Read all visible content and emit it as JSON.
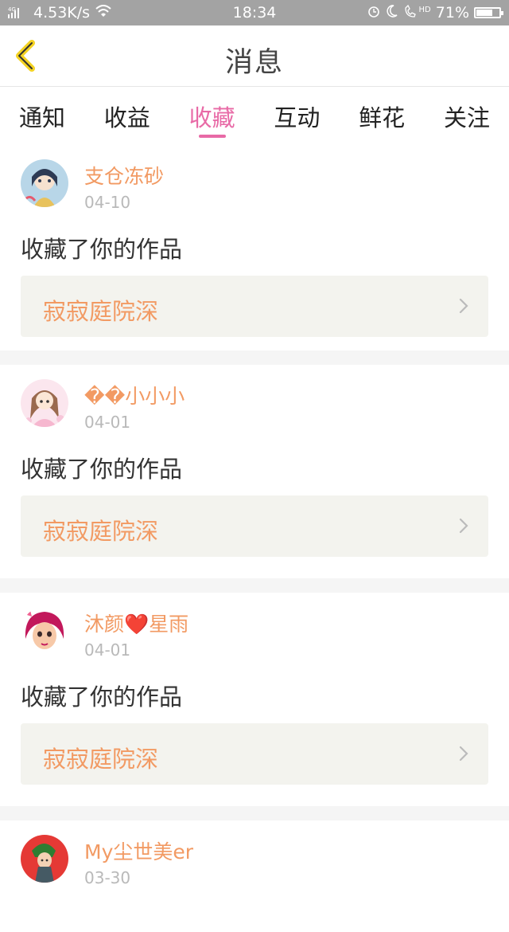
{
  "statusbar": {
    "signal": "4G",
    "speed": "4.53K/s",
    "time": "18:34",
    "network": "HD",
    "battery": "71%",
    "battery_level": 0.71
  },
  "header": {
    "title": "消息"
  },
  "tabs": [
    {
      "label": "通知",
      "active": false
    },
    {
      "label": "收益",
      "active": false
    },
    {
      "label": "收藏",
      "active": true
    },
    {
      "label": "互动",
      "active": false
    },
    {
      "label": "鲜花",
      "active": false
    },
    {
      "label": "关注",
      "active": false
    }
  ],
  "items": [
    {
      "name": "支仓冻砂",
      "date": "04-10",
      "action": "收藏了你的作品",
      "work": "寂寂庭院深"
    },
    {
      "name": "��小小小",
      "date": "04-01",
      "action": "收藏了你的作品",
      "work": "寂寂庭院深"
    },
    {
      "name": "沐颜❤️星雨",
      "date": "04-01",
      "action": "收藏了你的作品",
      "work": "寂寂庭院深"
    },
    {
      "name": "My尘世美er",
      "date": "03-30",
      "action": "",
      "work": ""
    }
  ],
  "colors": {
    "accent_pink": "#e86aa6",
    "accent_orange": "#f29a63",
    "back_yellow": "#f4d323"
  }
}
